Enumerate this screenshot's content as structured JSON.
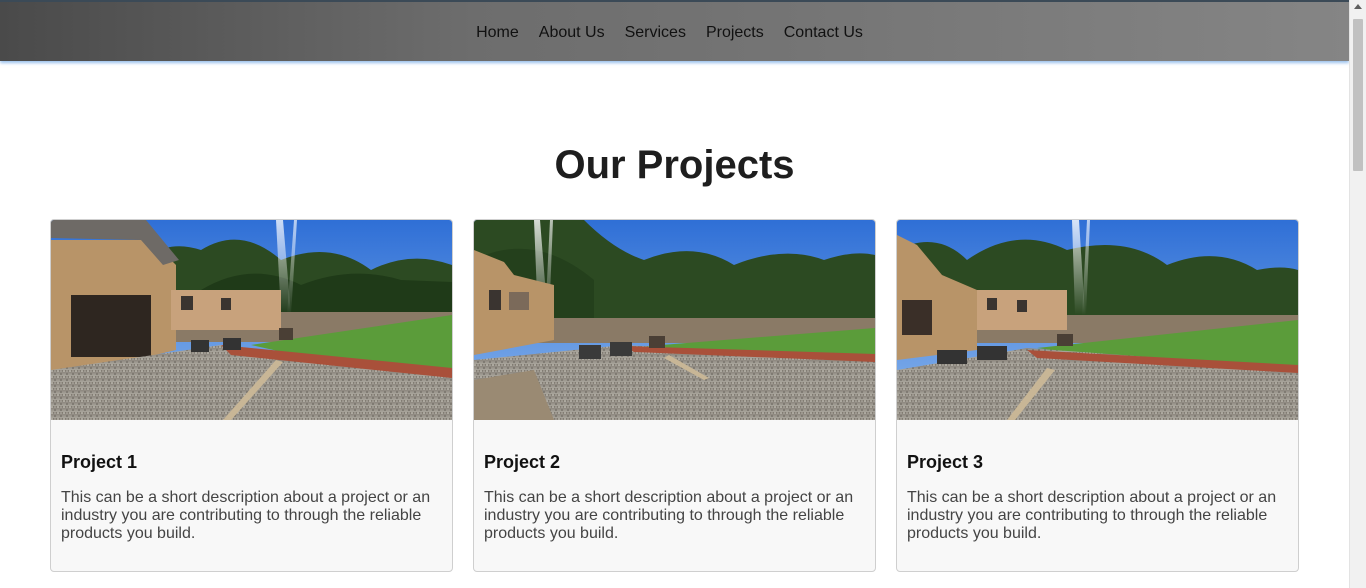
{
  "nav": {
    "links": [
      "Home",
      "About Us",
      "Services",
      "Projects",
      "Contact Us"
    ]
  },
  "page": {
    "title": "Our Projects"
  },
  "projects": [
    {
      "title": "Project 1",
      "description": "This can be a short description about a project or an industry you are contributing to through the reliable products you build."
    },
    {
      "title": "Project 2",
      "description": "This can be a short description about a project or an industry you are contributing to through the reliable products you build."
    },
    {
      "title": "Project 3",
      "description": "This can be a short description about a project or an industry you are contributing to through the reliable products you build."
    }
  ],
  "colors": {
    "nav_bg": "#6d6d6d",
    "nav_glow": "#4a90e2",
    "card_bg": "#f8f8f8",
    "sky": "#4f8fe0",
    "grass": "#5b9c3a",
    "gravel": "#9b9890"
  }
}
